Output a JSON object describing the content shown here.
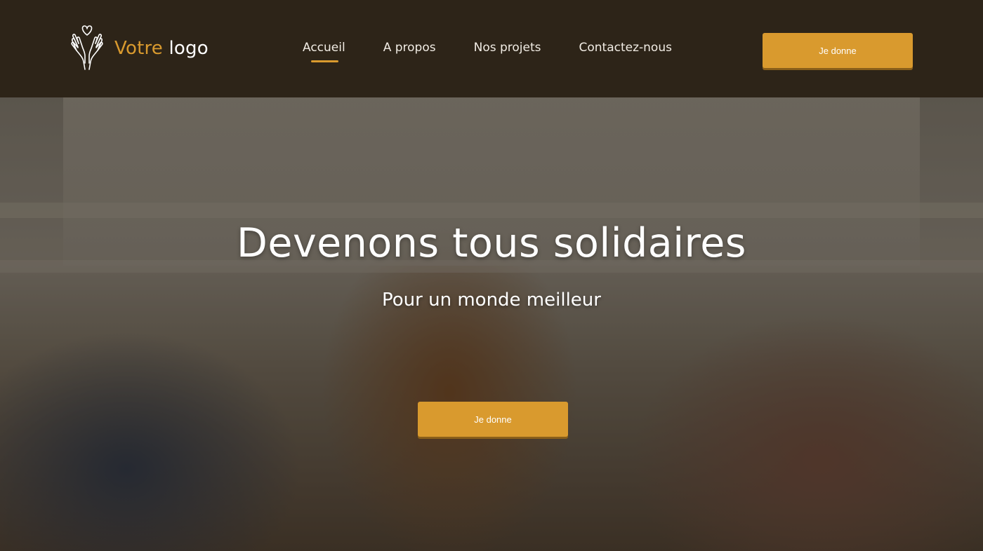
{
  "logo": {
    "icon": "hands-heart-icon",
    "text_accent": "Votre",
    "text_plain": "logo"
  },
  "nav": {
    "items": [
      {
        "label": "Accueil",
        "active": true
      },
      {
        "label": "A propos",
        "active": false
      },
      {
        "label": "Nos projets",
        "active": false
      },
      {
        "label": "Contactez-nous",
        "active": false
      }
    ]
  },
  "header": {
    "donate_label": "Je donne"
  },
  "hero": {
    "title": "Devenons tous solidaires",
    "subtitle": "Pour un monde meilleur",
    "donate_label": "Je donne"
  },
  "colors": {
    "header_bg": "#2d2418",
    "accent": "#d99a2e",
    "text": "#ffffff"
  }
}
